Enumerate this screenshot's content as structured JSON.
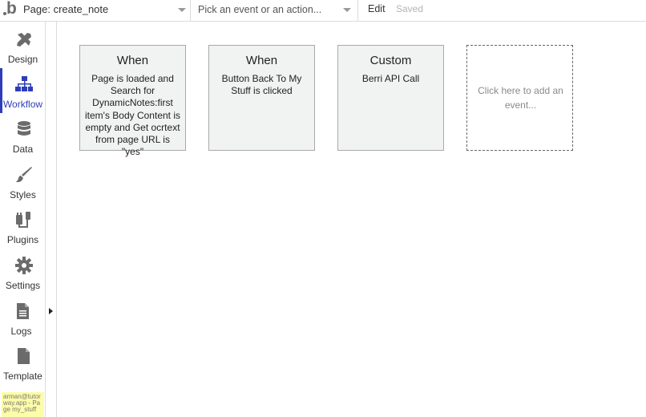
{
  "topbar": {
    "page_selector": "Page: create_note",
    "action_placeholder": "Pick an event or an action...",
    "edit_label": "Edit",
    "saved_label": "Saved"
  },
  "sidebar": {
    "items": [
      {
        "label": "Design",
        "icon": "design-icon"
      },
      {
        "label": "Workflow",
        "icon": "workflow-icon",
        "active": true
      },
      {
        "label": "Data",
        "icon": "database-icon"
      },
      {
        "label": "Styles",
        "icon": "brush-icon"
      },
      {
        "label": "Plugins",
        "icon": "plug-icon"
      },
      {
        "label": "Settings",
        "icon": "gear-icon"
      },
      {
        "label": "Logs",
        "icon": "document-icon"
      },
      {
        "label": "Template",
        "icon": "template-icon"
      }
    ],
    "user_tag": "arman@tutorway.app - Page my_stuff"
  },
  "events": [
    {
      "title": "When",
      "description": "Page is loaded and Search for DynamicNotes:first item's Body Content is empty and Get ocrtext from page URL is \"yes\""
    },
    {
      "title": "When",
      "description": "Button Back To My Stuff is clicked"
    },
    {
      "title": "Custom",
      "description": "Berri API Call"
    }
  ],
  "add_event": {
    "label": "Click here to add an event..."
  },
  "colors": {
    "accent": "#2f3db8",
    "icon": "#6b6b6b",
    "card_bg": "#f1f2f2",
    "user_tag_bg": "#fdfca8"
  }
}
